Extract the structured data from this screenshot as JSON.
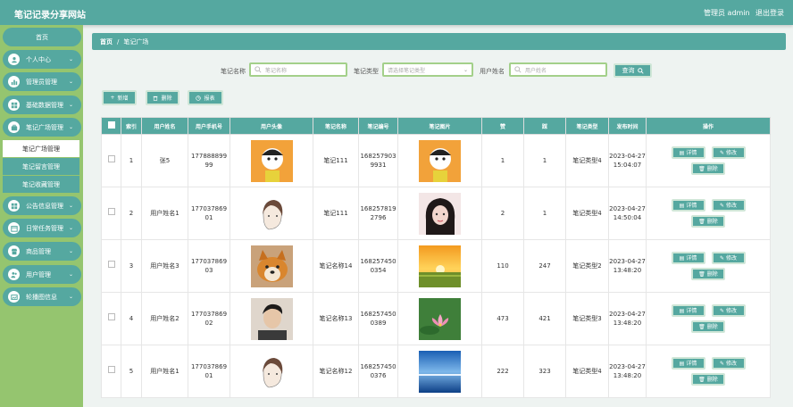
{
  "header": {
    "title": "笔记记录分享网站",
    "user": "管理员 admin",
    "logout": "退出登录"
  },
  "sidebar": {
    "home": "首页",
    "groups": [
      {
        "label": "个人中心",
        "icon": "user-icon"
      },
      {
        "label": "管理员管理",
        "icon": "chart-icon"
      },
      {
        "label": "基础数据管理",
        "icon": "grid-icon"
      },
      {
        "label": "笔记广场管理",
        "icon": "briefcase-icon"
      }
    ],
    "sub": [
      "笔记广场管理",
      "笔记留言管理",
      "笔记收藏管理"
    ],
    "groups2": [
      {
        "label": "公告信息管理",
        "icon": "grid-icon"
      },
      {
        "label": "日常任务管理",
        "icon": "calendar-icon"
      },
      {
        "label": "商品管理",
        "icon": "shop-icon"
      },
      {
        "label": "用户管理",
        "icon": "users-icon"
      },
      {
        "label": "轮播图信息",
        "icon": "image-icon"
      }
    ]
  },
  "breadcrumb": {
    "home": "首页",
    "sep": "/",
    "current": "笔记广场"
  },
  "filters": {
    "name_label": "笔记名称",
    "name_placeholder": "笔记名称",
    "type_label": "笔记类型",
    "type_placeholder": "请选择笔记类型",
    "user_label": "用户姓名",
    "user_placeholder": "用户姓名",
    "query": "查询"
  },
  "actions": {
    "add": "新增",
    "delete": "删除",
    "report": "报表"
  },
  "table": {
    "headers": [
      "索引",
      "用户姓名",
      "用户手机号",
      "用户头像",
      "笔记名称",
      "笔记编号",
      "笔记图片",
      "赞",
      "踩",
      "笔记类型",
      "发布时间",
      "操作"
    ],
    "rows": [
      {
        "index": "1",
        "name": "张5",
        "phone1": "177888899",
        "phone2": "99",
        "avatar": "cartoon",
        "note": "笔记111",
        "code1": "168257903",
        "code2": "9931",
        "image": "cartoon",
        "likes": "1",
        "dislikes": "1",
        "type": "笔记类型4",
        "date": "2023-04-27",
        "time": "15:04:07"
      },
      {
        "index": "2",
        "name": "用户姓名1",
        "phone1": "177037869",
        "phone2": "01",
        "avatar": "sketch",
        "note": "笔记111",
        "code1": "168257819",
        "code2": "2796",
        "image": "portrait",
        "likes": "2",
        "dislikes": "1",
        "type": "笔记类型4",
        "date": "2023-04-27",
        "time": "14:50:04"
      },
      {
        "index": "3",
        "name": "用户姓名3",
        "phone1": "177037869",
        "phone2": "03",
        "avatar": "dog",
        "note": "笔记名称14",
        "code1": "168257450",
        "code2": "0354",
        "image": "sunset",
        "likes": "110",
        "dislikes": "247",
        "type": "笔记类型2",
        "date": "2023-04-27",
        "time": "13:48:20"
      },
      {
        "index": "4",
        "name": "用户姓名2",
        "phone1": "177037869",
        "phone2": "02",
        "avatar": "man",
        "note": "笔记名称13",
        "code1": "168257450",
        "code2": "0389",
        "image": "lotus",
        "likes": "473",
        "dislikes": "421",
        "type": "笔记类型3",
        "date": "2023-04-27",
        "time": "13:48:20"
      },
      {
        "index": "5",
        "name": "用户姓名1",
        "phone1": "177037869",
        "phone2": "01",
        "avatar": "sketch",
        "note": "笔记名称12",
        "code1": "168257450",
        "code2": "0376",
        "image": "sea",
        "likes": "222",
        "dislikes": "323",
        "type": "笔记类型4",
        "date": "2023-04-27",
        "time": "13:48:20"
      }
    ],
    "ops": {
      "detail": "详情",
      "edit": "修改",
      "delete": "删除"
    }
  },
  "colors": {
    "primary": "#55a8a0",
    "sidebar": "#95c56f",
    "input_border": "#a3d08a"
  }
}
